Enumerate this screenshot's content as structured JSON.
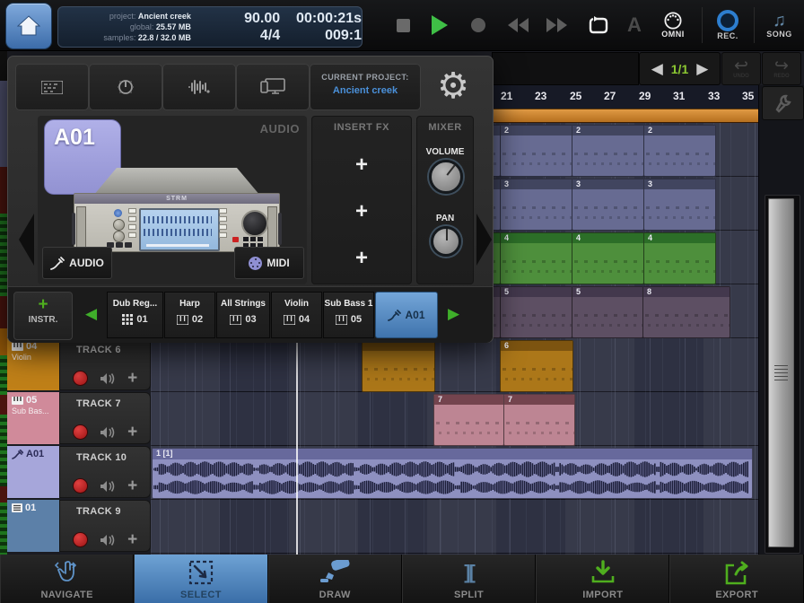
{
  "colors": {
    "accent_blue": "#4a90d9",
    "selected_tab_blue": "#4f86bd",
    "transport_play_green": "#3fbf46",
    "tool_green": "#4fae1e",
    "page_indicator_green": "#8cc832",
    "loop_bar_orange": "#c98027",
    "record_red": "#c22222",
    "clip_purple": "#676b92",
    "clip_green": "#4e8f3c",
    "clip_muted_purple": "#5d4f63",
    "clip_orange": "#ac7719",
    "clip_pink": "#bd8593",
    "clip_waveform_lavender": "#8e90c0",
    "track_orange": "#c08018",
    "track_pink": "#d08a9a",
    "track_lavender": "#a6a6da",
    "track_steel_blue": "#5c80a8",
    "badge_lavender": "#a2a2de"
  },
  "top_bar": {
    "project_label": "project:",
    "project_value": "Ancient creek",
    "global_label": "global:",
    "global_value": "25.57 MB",
    "samples_label": "samples:",
    "samples_value": "22.8 / 32.0 MB",
    "tempo": "90.00",
    "time_signature": "4/4",
    "time_display": "00:00:21s",
    "bar_beat": "009:1",
    "metronome_glyph": "A",
    "omni_label": "OMNI",
    "rec_label": "REC.",
    "song_label": "SONG"
  },
  "popup": {
    "current_project_label": "CURRENT PROJECT:",
    "current_project_value": "Ancient creek",
    "badge": "A01",
    "channel_type_label": "AUDIO",
    "device_brand": "STRM",
    "audio_button_label": "AUDIO",
    "midi_button_label": "MIDI",
    "insert_fx_label": "INSERT FX",
    "fx_plus": "+",
    "mixer_label": "MIXER",
    "volume_label": "VOLUME",
    "pan_label": "PAN",
    "add_instrument_plus": "+",
    "add_instrument_label": "INSTR.",
    "instruments": [
      {
        "name": "Dub Reg...",
        "num": "01"
      },
      {
        "name": "Harp",
        "num": "02"
      },
      {
        "name": "All Strings",
        "num": "03"
      },
      {
        "name": "Violin",
        "num": "04"
      },
      {
        "name": "Sub Bass 1",
        "num": "05"
      },
      {
        "name": "A01",
        "num": ""
      }
    ]
  },
  "timeline": {
    "page_indicator": "1/1",
    "undo_label": "UNDO",
    "redo_label": "REDO",
    "ruler_ticks": [
      "21",
      "23",
      "25",
      "27",
      "29",
      "31",
      "33",
      "35"
    ]
  },
  "clips": {
    "row2": [
      "2",
      "2",
      "2"
    ],
    "row3": [
      "3",
      "3",
      "3"
    ],
    "row4": [
      "4",
      "4",
      "4"
    ],
    "row5": [
      "5",
      "5",
      "8"
    ],
    "row6": [
      "6"
    ],
    "row7": [
      "7",
      "7"
    ],
    "row10": [
      "1 [1]"
    ]
  },
  "tracks": [
    {
      "badge_num": "04",
      "badge_name": "Violin",
      "name": "TRACK 6",
      "color": "#c08018"
    },
    {
      "badge_num": "05",
      "badge_name": "Sub Bas...",
      "name": "TRACK 7",
      "color": "#d08a9a"
    },
    {
      "badge_num": "A01",
      "badge_name": "",
      "name": "TRACK 10",
      "color": "#a6a6da"
    },
    {
      "badge_num": "01",
      "badge_name": "",
      "name": "TRACK 9",
      "color": "#5c80a8"
    }
  ],
  "toolbar": {
    "items": [
      {
        "label": "NAVIGATE",
        "selected": false
      },
      {
        "label": "SELECT",
        "selected": true
      },
      {
        "label": "DRAW",
        "selected": false
      },
      {
        "label": "SPLIT",
        "selected": false
      },
      {
        "label": "IMPORT",
        "selected": false
      },
      {
        "label": "EXPORT",
        "selected": false
      }
    ]
  },
  "icons": {
    "gear": "⚙",
    "prev": "◀",
    "next": "▶",
    "undo": "↩",
    "redo": "↪",
    "song_note": "♫",
    "split_glyph": "]["
  }
}
